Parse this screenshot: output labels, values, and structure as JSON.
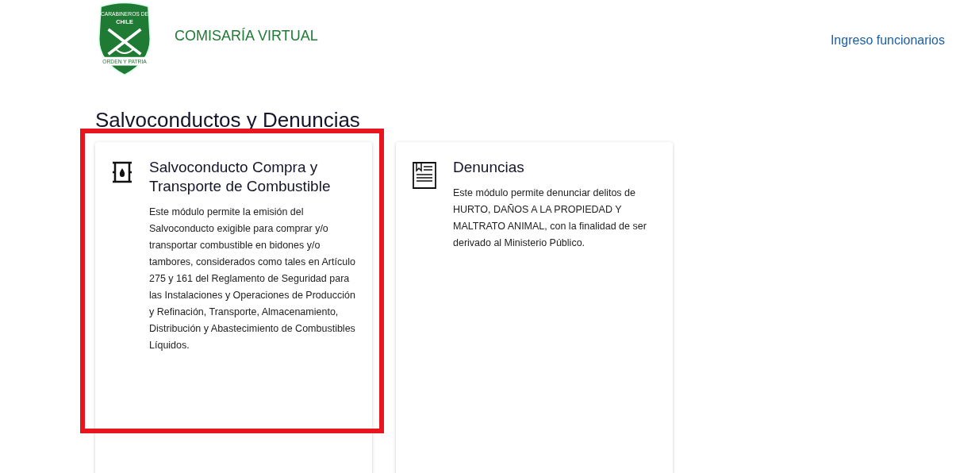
{
  "header": {
    "logo": {
      "top_text": "CARABINEROS DE",
      "middle_text": "CHILE",
      "motto": "ORDEN Y PATRIA"
    },
    "site_title": "COMISARÍA VIRTUAL",
    "staff_link": "Ingreso funcionarios"
  },
  "section_title": "Salvoconductos y Denuncias",
  "cards": [
    {
      "kind": "fuel",
      "highlighted": true,
      "title": "Salvoconducto Compra y Transporte de Combustible",
      "description": "Este módulo permite la emisión del Salvoconducto exigible para comprar y/o transportar combustible en bidones y/o tambores, considerados como tales en Artículo 275 y 161 del Reglamento de Seguridad para las Instalaciones y Operaciones de Producción y Refinación, Transporte, Almacenamiento, Distribución y Abastecimiento de Combustibles Líquidos."
    },
    {
      "kind": "report",
      "highlighted": false,
      "title": "Denuncias",
      "description": "Este módulo permite denunciar delitos de HURTO, DAÑOS A LA PROPIEDAD Y MALTRATO ANIMAL, con la finalidad de ser derivado al Ministerio Público."
    }
  ]
}
